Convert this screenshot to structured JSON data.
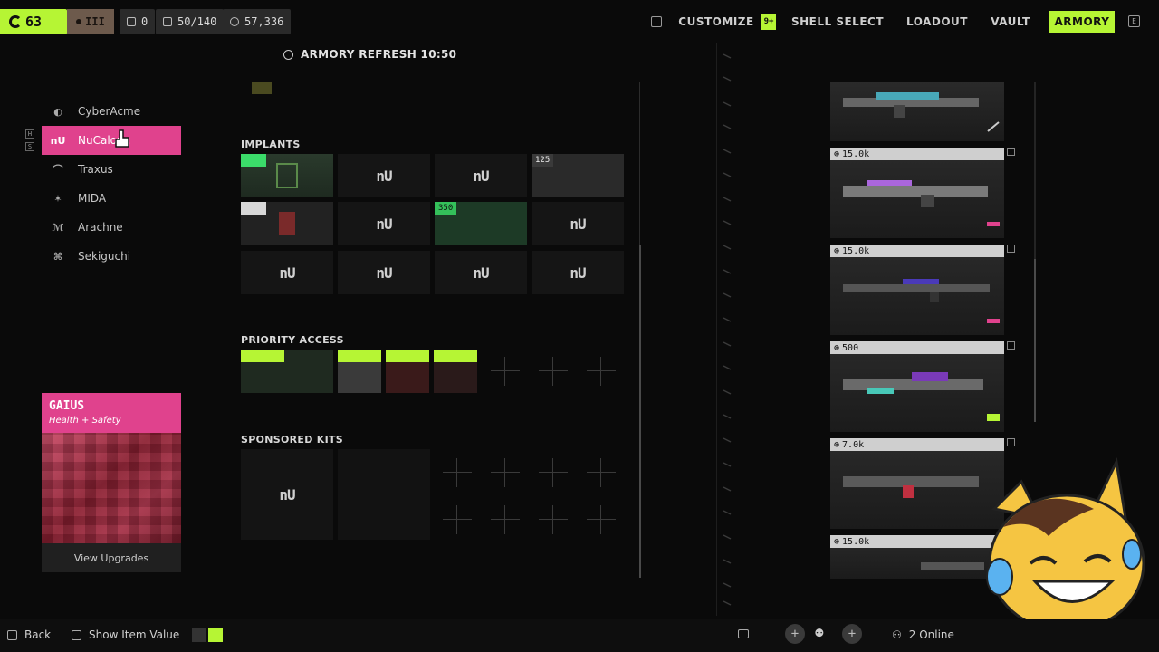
{
  "topbar": {
    "level": "63",
    "rank_glyph": "III",
    "stat_zero": "0",
    "capacity": "50/140",
    "credits": "57,336",
    "nav": [
      {
        "label": "CUSTOMIZE",
        "badge": "9+"
      },
      {
        "label": "SHELL SELECT"
      },
      {
        "label": "LOADOUT"
      },
      {
        "label": "VAULT"
      },
      {
        "label": "ARMORY",
        "active": true
      }
    ],
    "key_hint": "E"
  },
  "armory": {
    "refresh_label": "ARMORY REFRESH 10:50"
  },
  "sidebar": {
    "items": [
      {
        "label": "CyberAcme",
        "logo": "◐"
      },
      {
        "label": "NuCaloric",
        "logo": "nU",
        "active": true
      },
      {
        "label": "Traxus",
        "logo": "⌒"
      },
      {
        "label": "MIDA",
        "logo": "✶"
      },
      {
        "label": "Arachne",
        "logo": "ℳ"
      },
      {
        "label": "Sekiguchi",
        "logo": "⌘"
      }
    ],
    "hint_keys": [
      "H",
      "S"
    ]
  },
  "card": {
    "title": "GAIUS",
    "subtitle": "Health + Safety",
    "button": "View Upgrades"
  },
  "sections": {
    "implants": "IMPLANTS",
    "priority": "PRIORITY ACCESS",
    "sponsored": "SPONSORED KITS"
  },
  "implant_prices": {
    "slot4": "125",
    "slot7": "350"
  },
  "slot_logo": "nU",
  "weapons": [
    {
      "price": ""
    },
    {
      "price": "15.0k"
    },
    {
      "price": "15.0k"
    },
    {
      "price": "500"
    },
    {
      "price": "7.0k"
    },
    {
      "price": "15.0k"
    }
  ],
  "bottom": {
    "back": "Back",
    "show_value": "Show Item Value",
    "online": "2 Online"
  },
  "colors": {
    "accent": "#b6f534",
    "brand_pink": "#e0428d"
  }
}
